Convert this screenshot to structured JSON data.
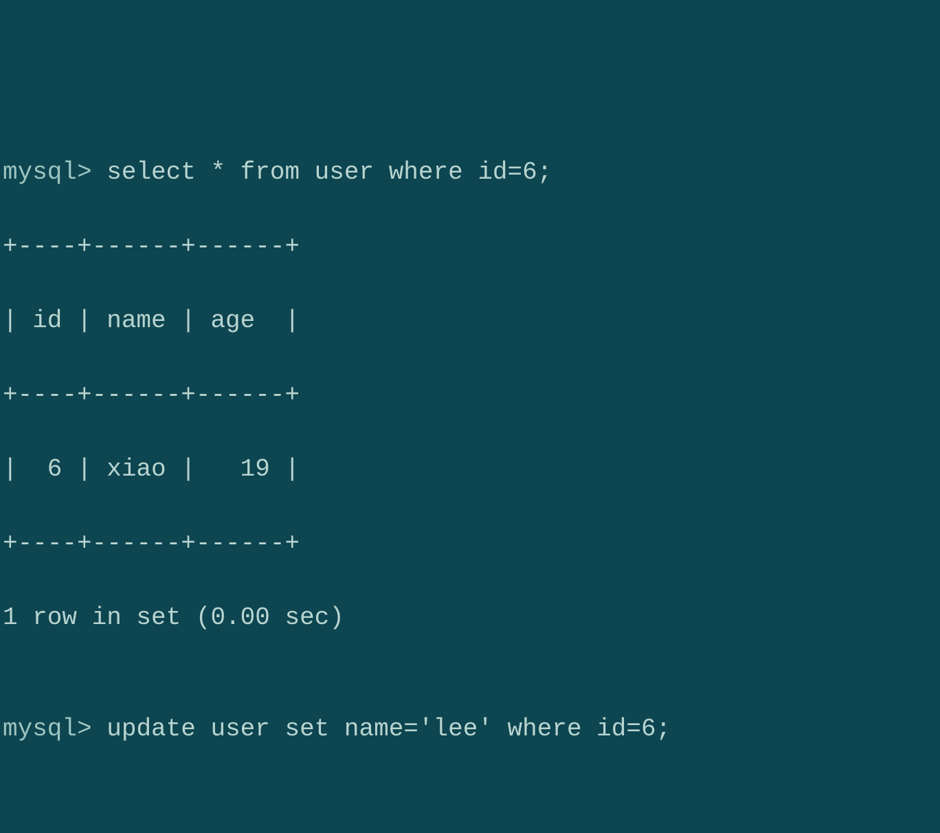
{
  "terminal": {
    "prompt": "mysql> ",
    "query1": "select * from user where id=6;",
    "table": {
      "border_top": "+----+------+------+",
      "header": "| id | name | age  |",
      "border_mid": "+----+------+------+",
      "row1": "|  6 | xiao |   19 |",
      "border_bot": "+----+------+------+"
    },
    "result_status": "1 row in set (0.00 sec)",
    "blank": "",
    "query2": "update user set name='lee' where id=6;"
  }
}
